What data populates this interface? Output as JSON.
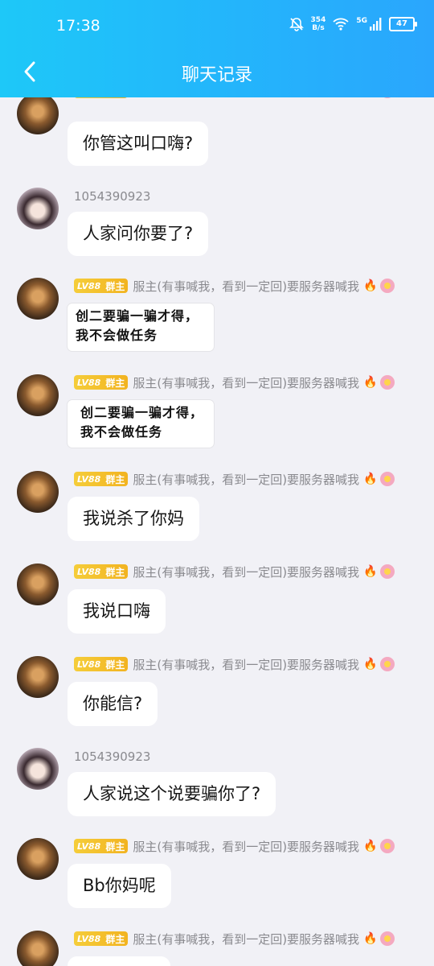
{
  "status_bar": {
    "time": "17:38",
    "net_speed_value": "354",
    "net_speed_unit": "B/s",
    "network": "5G",
    "battery": "47"
  },
  "header": {
    "title": "聊天记录"
  },
  "badge": {
    "level": "LV88",
    "role": "群主"
  },
  "admin_nick": "服主(有事喊我，看到一定回)要服务器喊我",
  "user_id": "1054390923",
  "messages": [
    {
      "text": "你管这叫口嗨?"
    },
    {
      "text": "人家问你要了?"
    },
    {
      "line1": "创二要骗一骗才得，",
      "line2": "我不会做任务"
    },
    {
      "line1": "创二要骗一骗才得，",
      "line2": "我不会做任务"
    },
    {
      "text": "我说杀了你妈"
    },
    {
      "text": "我说口嗨"
    },
    {
      "text": "你能信?"
    },
    {
      "text": "人家说这个说要骗你了?"
    },
    {
      "text": "Bb你妈呢"
    }
  ],
  "colors": {
    "header_start": "#1ec8f8",
    "header_end": "#2aa6fd",
    "badge": "#f2b320",
    "background": "#f1f1f6"
  }
}
